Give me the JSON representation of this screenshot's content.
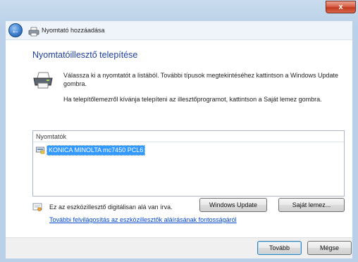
{
  "window": {
    "title": "Nyomtató hozzáadása",
    "close_glyph": "x"
  },
  "header": {
    "back_glyph": "←"
  },
  "main": {
    "heading": "Nyomtatóillesztő telepítése",
    "description_1": "Válassza ki a nyomtatót a listából. További típusok megtekintéséhez kattintson a Windows Update gombra.",
    "description_2": "Ha telepítőlemezről kívánja telepíteni az illesztőprogramot, kattintson a Saját lemez gombra."
  },
  "printer_list": {
    "column_header": "Nyomtatók",
    "items": [
      {
        "label": "KONICA MINOLTA mc7450 PCL6",
        "selected": true
      }
    ]
  },
  "signature": {
    "text": "Ez az eszközillesztő digitálisan alá van írva.",
    "link": "További felvilágosítás az eszközillesztők aláírásának fontosságáról"
  },
  "buttons": {
    "windows_update": "Windows Update",
    "have_disk": "Saját lemez...",
    "next": "Tovább",
    "cancel": "Mégse"
  },
  "colors": {
    "heading": "#1e3fa0",
    "selection": "#3399ff",
    "link": "#0046d5"
  },
  "icons": {
    "back": "back-arrow-icon",
    "printer_small": "printer-icon",
    "printer_big": "printer-icon",
    "list_item": "printer-driver-icon",
    "signed": "certificate-icon"
  }
}
